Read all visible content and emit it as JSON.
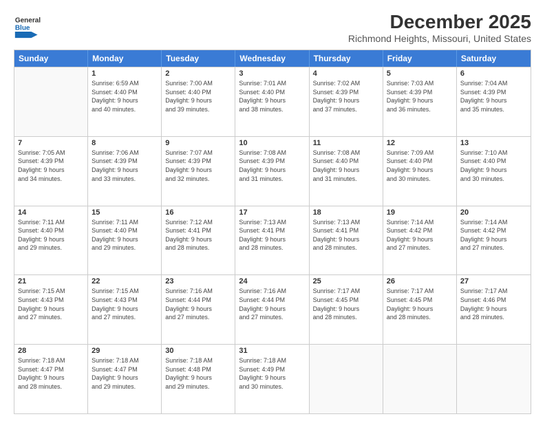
{
  "logo": {
    "text_general": "General",
    "text_blue": "Blue"
  },
  "title": "December 2025",
  "subtitle": "Richmond Heights, Missouri, United States",
  "days": [
    "Sunday",
    "Monday",
    "Tuesday",
    "Wednesday",
    "Thursday",
    "Friday",
    "Saturday"
  ],
  "rows": [
    [
      {
        "num": "",
        "lines": []
      },
      {
        "num": "1",
        "lines": [
          "Sunrise: 6:59 AM",
          "Sunset: 4:40 PM",
          "Daylight: 9 hours",
          "and 40 minutes."
        ]
      },
      {
        "num": "2",
        "lines": [
          "Sunrise: 7:00 AM",
          "Sunset: 4:40 PM",
          "Daylight: 9 hours",
          "and 39 minutes."
        ]
      },
      {
        "num": "3",
        "lines": [
          "Sunrise: 7:01 AM",
          "Sunset: 4:40 PM",
          "Daylight: 9 hours",
          "and 38 minutes."
        ]
      },
      {
        "num": "4",
        "lines": [
          "Sunrise: 7:02 AM",
          "Sunset: 4:39 PM",
          "Daylight: 9 hours",
          "and 37 minutes."
        ]
      },
      {
        "num": "5",
        "lines": [
          "Sunrise: 7:03 AM",
          "Sunset: 4:39 PM",
          "Daylight: 9 hours",
          "and 36 minutes."
        ]
      },
      {
        "num": "6",
        "lines": [
          "Sunrise: 7:04 AM",
          "Sunset: 4:39 PM",
          "Daylight: 9 hours",
          "and 35 minutes."
        ]
      }
    ],
    [
      {
        "num": "7",
        "lines": [
          "Sunrise: 7:05 AM",
          "Sunset: 4:39 PM",
          "Daylight: 9 hours",
          "and 34 minutes."
        ]
      },
      {
        "num": "8",
        "lines": [
          "Sunrise: 7:06 AM",
          "Sunset: 4:39 PM",
          "Daylight: 9 hours",
          "and 33 minutes."
        ]
      },
      {
        "num": "9",
        "lines": [
          "Sunrise: 7:07 AM",
          "Sunset: 4:39 PM",
          "Daylight: 9 hours",
          "and 32 minutes."
        ]
      },
      {
        "num": "10",
        "lines": [
          "Sunrise: 7:08 AM",
          "Sunset: 4:39 PM",
          "Daylight: 9 hours",
          "and 31 minutes."
        ]
      },
      {
        "num": "11",
        "lines": [
          "Sunrise: 7:08 AM",
          "Sunset: 4:40 PM",
          "Daylight: 9 hours",
          "and 31 minutes."
        ]
      },
      {
        "num": "12",
        "lines": [
          "Sunrise: 7:09 AM",
          "Sunset: 4:40 PM",
          "Daylight: 9 hours",
          "and 30 minutes."
        ]
      },
      {
        "num": "13",
        "lines": [
          "Sunrise: 7:10 AM",
          "Sunset: 4:40 PM",
          "Daylight: 9 hours",
          "and 30 minutes."
        ]
      }
    ],
    [
      {
        "num": "14",
        "lines": [
          "Sunrise: 7:11 AM",
          "Sunset: 4:40 PM",
          "Daylight: 9 hours",
          "and 29 minutes."
        ]
      },
      {
        "num": "15",
        "lines": [
          "Sunrise: 7:11 AM",
          "Sunset: 4:40 PM",
          "Daylight: 9 hours",
          "and 29 minutes."
        ]
      },
      {
        "num": "16",
        "lines": [
          "Sunrise: 7:12 AM",
          "Sunset: 4:41 PM",
          "Daylight: 9 hours",
          "and 28 minutes."
        ]
      },
      {
        "num": "17",
        "lines": [
          "Sunrise: 7:13 AM",
          "Sunset: 4:41 PM",
          "Daylight: 9 hours",
          "and 28 minutes."
        ]
      },
      {
        "num": "18",
        "lines": [
          "Sunrise: 7:13 AM",
          "Sunset: 4:41 PM",
          "Daylight: 9 hours",
          "and 28 minutes."
        ]
      },
      {
        "num": "19",
        "lines": [
          "Sunrise: 7:14 AM",
          "Sunset: 4:42 PM",
          "Daylight: 9 hours",
          "and 27 minutes."
        ]
      },
      {
        "num": "20",
        "lines": [
          "Sunrise: 7:14 AM",
          "Sunset: 4:42 PM",
          "Daylight: 9 hours",
          "and 27 minutes."
        ]
      }
    ],
    [
      {
        "num": "21",
        "lines": [
          "Sunrise: 7:15 AM",
          "Sunset: 4:43 PM",
          "Daylight: 9 hours",
          "and 27 minutes."
        ]
      },
      {
        "num": "22",
        "lines": [
          "Sunrise: 7:15 AM",
          "Sunset: 4:43 PM",
          "Daylight: 9 hours",
          "and 27 minutes."
        ]
      },
      {
        "num": "23",
        "lines": [
          "Sunrise: 7:16 AM",
          "Sunset: 4:44 PM",
          "Daylight: 9 hours",
          "and 27 minutes."
        ]
      },
      {
        "num": "24",
        "lines": [
          "Sunrise: 7:16 AM",
          "Sunset: 4:44 PM",
          "Daylight: 9 hours",
          "and 27 minutes."
        ]
      },
      {
        "num": "25",
        "lines": [
          "Sunrise: 7:17 AM",
          "Sunset: 4:45 PM",
          "Daylight: 9 hours",
          "and 28 minutes."
        ]
      },
      {
        "num": "26",
        "lines": [
          "Sunrise: 7:17 AM",
          "Sunset: 4:45 PM",
          "Daylight: 9 hours",
          "and 28 minutes."
        ]
      },
      {
        "num": "27",
        "lines": [
          "Sunrise: 7:17 AM",
          "Sunset: 4:46 PM",
          "Daylight: 9 hours",
          "and 28 minutes."
        ]
      }
    ],
    [
      {
        "num": "28",
        "lines": [
          "Sunrise: 7:18 AM",
          "Sunset: 4:47 PM",
          "Daylight: 9 hours",
          "and 28 minutes."
        ]
      },
      {
        "num": "29",
        "lines": [
          "Sunrise: 7:18 AM",
          "Sunset: 4:47 PM",
          "Daylight: 9 hours",
          "and 29 minutes."
        ]
      },
      {
        "num": "30",
        "lines": [
          "Sunrise: 7:18 AM",
          "Sunset: 4:48 PM",
          "Daylight: 9 hours",
          "and 29 minutes."
        ]
      },
      {
        "num": "31",
        "lines": [
          "Sunrise: 7:18 AM",
          "Sunset: 4:49 PM",
          "Daylight: 9 hours",
          "and 30 minutes."
        ]
      },
      {
        "num": "",
        "lines": []
      },
      {
        "num": "",
        "lines": []
      },
      {
        "num": "",
        "lines": []
      }
    ]
  ]
}
